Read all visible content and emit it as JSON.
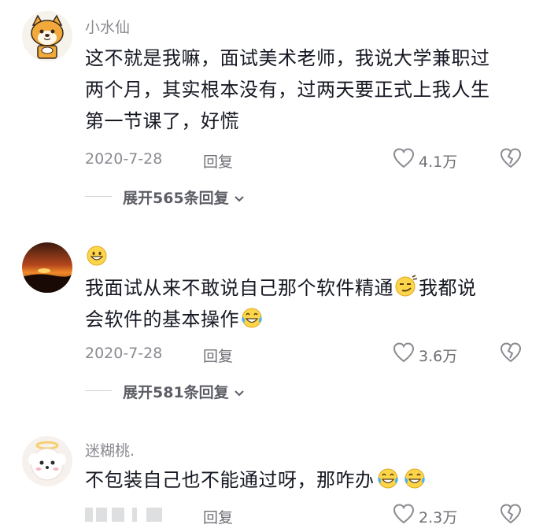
{
  "comments": [
    {
      "author": "小水仙",
      "line1": "这不就是我嘛，面试美术老师，我说大学兼职过",
      "line2": "两个月，其实根本没有，过两天要正式上我人生",
      "line3": "第一节课了，好慌",
      "date": "2020-7-28",
      "reply_label": "回复",
      "likes": "4.1万",
      "expand_label": "展开565条回复"
    },
    {
      "author_icon": "grinning-face-emoji",
      "line1": "我面试从来不敢说自己那个软件精通",
      "line1b": "我都说",
      "line2": "会软件的基本操作",
      "date": "2020-7-28",
      "reply_label": "回复",
      "likes": "3.6万",
      "expand_label": "展开581条回复"
    },
    {
      "author": "迷糊桃.",
      "line1": "不包装自己也不能通过呀，那咋办",
      "reply_label": "回复",
      "likes": "2.3万"
    }
  ],
  "colors": {
    "text": "#161823",
    "muted": "#8a8b91",
    "emoji": "#f8c53a"
  }
}
